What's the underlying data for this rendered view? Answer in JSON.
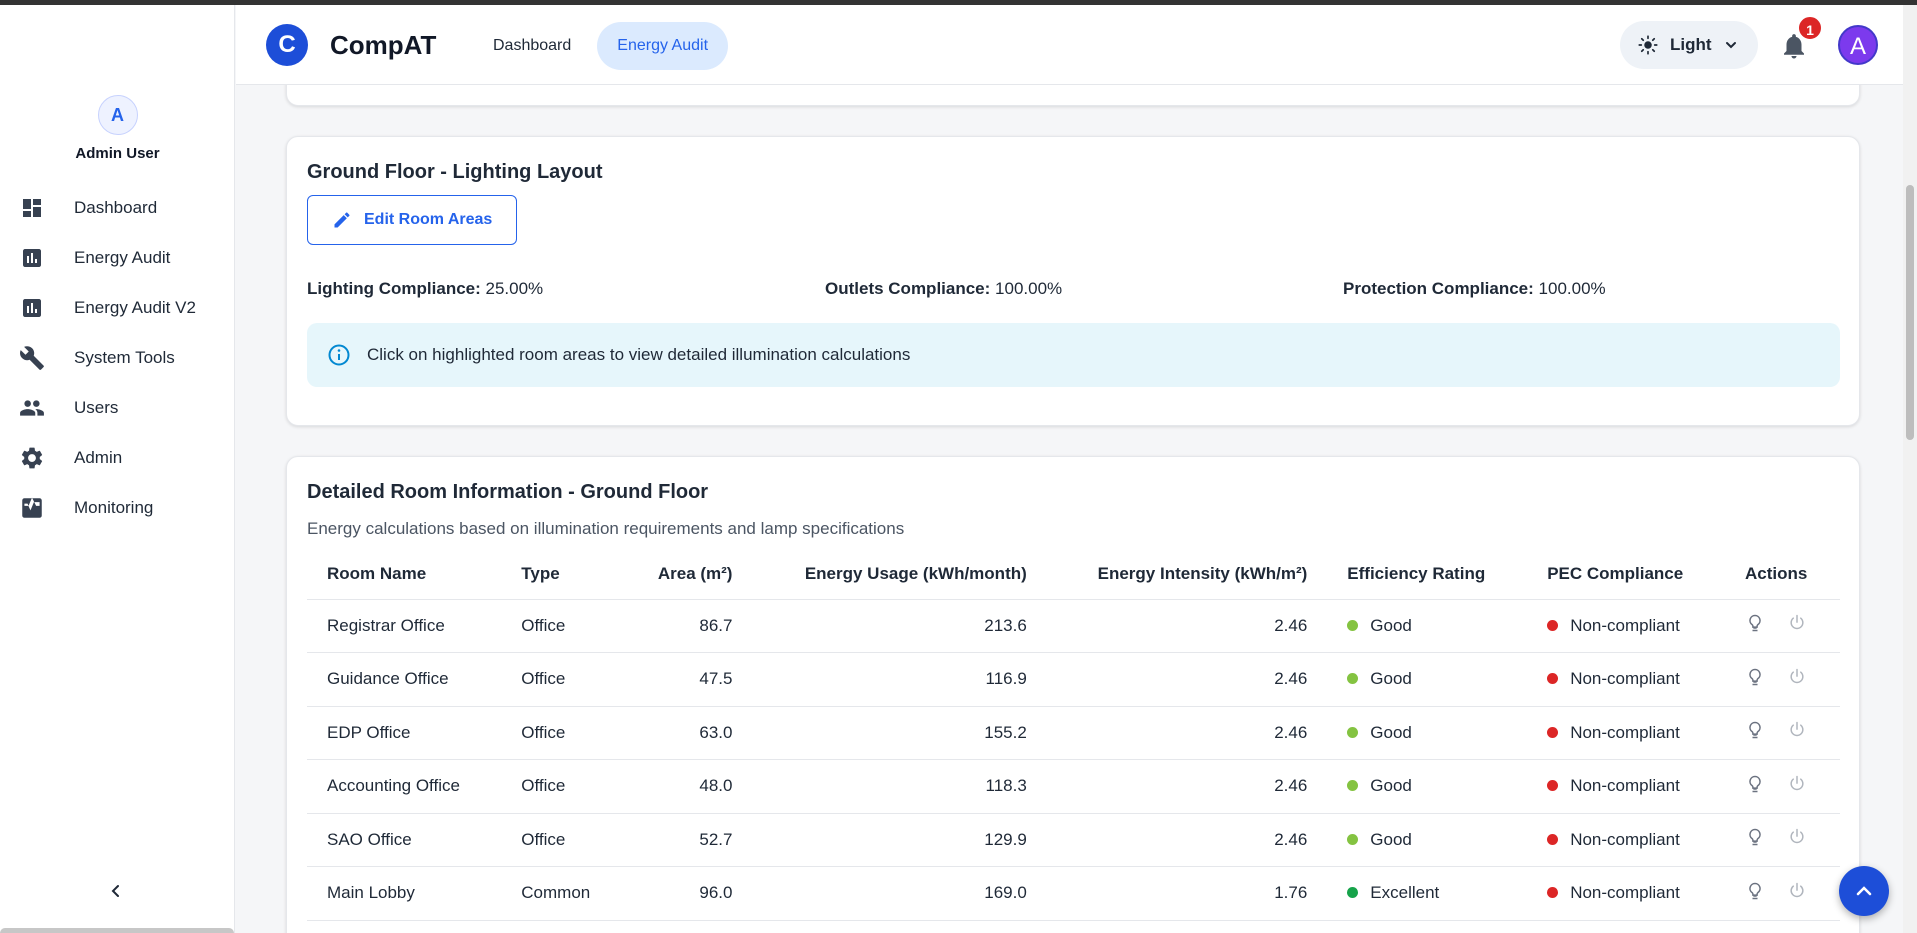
{
  "app": {
    "logo_letter": "C",
    "name": "CompAT"
  },
  "header": {
    "nav": [
      {
        "label": "Dashboard"
      },
      {
        "label": "Energy Audit"
      }
    ],
    "theme_label": "Light",
    "notification_count": "1",
    "user_initial": "A"
  },
  "sidebar": {
    "user_initial": "A",
    "user_name": "Admin User",
    "items": [
      {
        "label": "Dashboard",
        "icon": "dashboard-icon"
      },
      {
        "label": "Energy Audit",
        "icon": "bar-chart-icon"
      },
      {
        "label": "Energy Audit V2",
        "icon": "bar-chart-icon"
      },
      {
        "label": "System Tools",
        "icon": "wrench-icon"
      },
      {
        "label": "Users",
        "icon": "users-icon"
      },
      {
        "label": "Admin",
        "icon": "gear-icon"
      },
      {
        "label": "Monitoring",
        "icon": "monitoring-icon"
      }
    ]
  },
  "layout_card": {
    "title": "Ground Floor - Lighting Layout",
    "edit_button": "Edit Room Areas",
    "lighting_label": "Lighting Compliance:",
    "lighting_value": "25.00%",
    "outlets_label": "Outlets Compliance:",
    "outlets_value": "100.00%",
    "protection_label": "Protection Compliance:",
    "protection_value": "100.00%",
    "info_text": "Click on highlighted room areas to view detailed illumination calculations"
  },
  "rooms_card": {
    "title": "Detailed Room Information - Ground Floor",
    "subtitle": "Energy calculations based on illumination requirements and lamp specifications",
    "columns": [
      "Room Name",
      "Type",
      "Area (m²)",
      "Energy Usage (kWh/month)",
      "Energy Intensity (kWh/m²)",
      "Efficiency Rating",
      "PEC Compliance",
      "Actions"
    ],
    "rows": [
      {
        "name": "Registrar Office",
        "type": "Office",
        "area": "86.7",
        "usage": "213.6",
        "intensity": "2.46",
        "rating": "Good",
        "compliance": "Non-compliant"
      },
      {
        "name": "Guidance Office",
        "type": "Office",
        "area": "47.5",
        "usage": "116.9",
        "intensity": "2.46",
        "rating": "Good",
        "compliance": "Non-compliant"
      },
      {
        "name": "EDP Office",
        "type": "Office",
        "area": "63.0",
        "usage": "155.2",
        "intensity": "2.46",
        "rating": "Good",
        "compliance": "Non-compliant"
      },
      {
        "name": "Accounting Office",
        "type": "Office",
        "area": "48.0",
        "usage": "118.3",
        "intensity": "2.46",
        "rating": "Good",
        "compliance": "Non-compliant"
      },
      {
        "name": "SAO Office",
        "type": "Office",
        "area": "52.7",
        "usage": "129.9",
        "intensity": "2.46",
        "rating": "Good",
        "compliance": "Non-compliant"
      },
      {
        "name": "Main Lobby",
        "type": "Common",
        "area": "96.0",
        "usage": "169.0",
        "intensity": "1.76",
        "rating": "Excellent",
        "compliance": "Non-compliant"
      }
    ]
  },
  "colors": {
    "primary": "#2563eb",
    "good": "#84c341",
    "excellent": "#16a34a",
    "noncompliant": "#dc2626",
    "info_bg": "#e6f6fb"
  }
}
